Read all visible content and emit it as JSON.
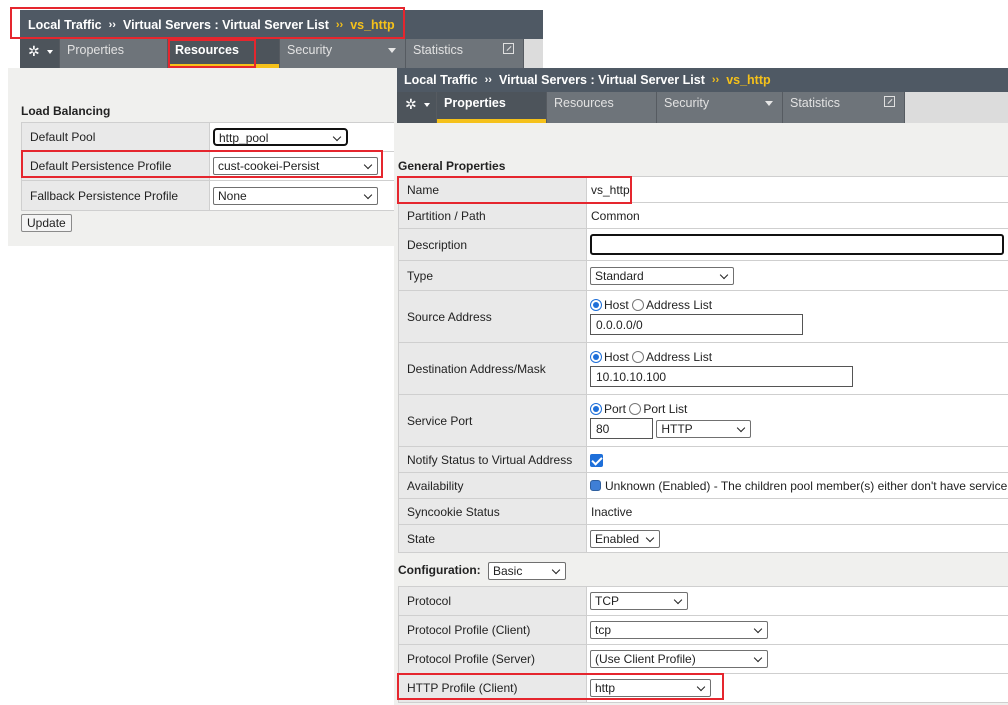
{
  "left_panel": {
    "breadcrumb": {
      "part1": "Local Traffic",
      "part2": "Virtual Servers : Virtual Server List",
      "current": "vs_http",
      "sep": "››"
    },
    "tabs": {
      "properties": "Properties",
      "resources": "Resources",
      "security": "Security",
      "statistics": "Statistics"
    },
    "section_title": "Load Balancing",
    "rows": {
      "default_pool": {
        "label": "Default Pool",
        "value": "http_pool"
      },
      "default_persistence": {
        "label": "Default Persistence Profile",
        "value": "cust-cookei-Persist"
      },
      "fallback_persistence": {
        "label": "Fallback Persistence Profile",
        "value": "None"
      }
    },
    "update_button": "Update"
  },
  "right_panel": {
    "breadcrumb": {
      "part1": "Local Traffic",
      "part2": "Virtual Servers : Virtual Server List",
      "current": "vs_http",
      "sep": "››"
    },
    "tabs": {
      "properties": "Properties",
      "resources": "Resources",
      "security": "Security",
      "statistics": "Statistics"
    },
    "general_title": "General Properties",
    "general": {
      "name": {
        "label": "Name",
        "value": "vs_http"
      },
      "partition": {
        "label": "Partition / Path",
        "value": "Common"
      },
      "description": {
        "label": "Description",
        "value": ""
      },
      "type": {
        "label": "Type",
        "value": "Standard"
      },
      "source": {
        "label": "Source Address",
        "host": "Host",
        "list": "Address List",
        "value": "0.0.0.0/0"
      },
      "destination": {
        "label": "Destination Address/Mask",
        "host": "Host",
        "list": "Address List",
        "value": "10.10.10.100"
      },
      "service_port": {
        "label": "Service Port",
        "port": "Port",
        "list": "Port List",
        "value": "80",
        "protocol": "HTTP"
      },
      "notify": {
        "label": "Notify Status to Virtual Address",
        "checked": true
      },
      "availability": {
        "label": "Availability",
        "value": "Unknown (Enabled) - The children pool member(s) either don't have service"
      },
      "syncookie": {
        "label": "Syncookie Status",
        "value": "Inactive"
      },
      "state": {
        "label": "State",
        "value": "Enabled"
      }
    },
    "configuration": {
      "label": "Configuration:",
      "value": "Basic"
    },
    "config_rows": {
      "protocol": {
        "label": "Protocol",
        "value": "TCP"
      },
      "profile_client": {
        "label": "Protocol Profile (Client)",
        "value": "tcp"
      },
      "profile_server": {
        "label": "Protocol Profile (Server)",
        "value": "(Use Client Profile)"
      },
      "http_profile": {
        "label": "HTTP Profile (Client)",
        "value": "http"
      }
    }
  },
  "colors": {
    "accent": "#f5c11a",
    "highlight": "#e5262e",
    "header": "#4f5964",
    "tab": "#6e747a"
  }
}
